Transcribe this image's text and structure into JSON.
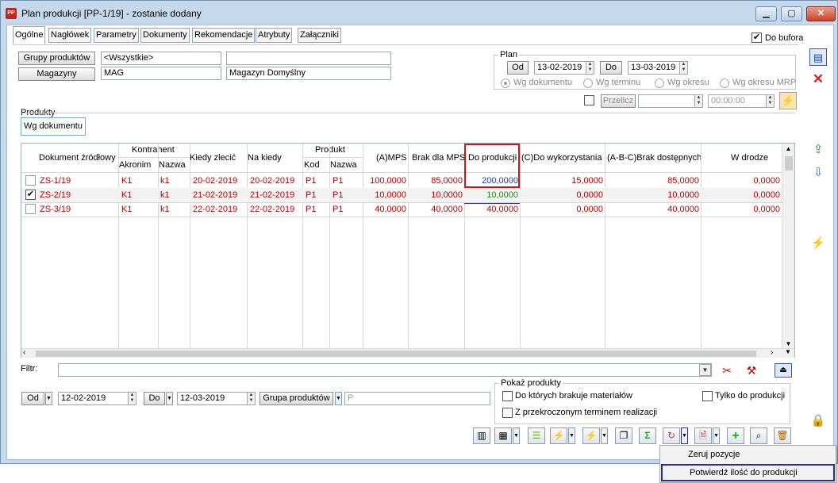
{
  "window": {
    "title": "Plan produkcji [PP-1/19] - zostanie dodany",
    "app_icon": "PP"
  },
  "tabs": [
    "Ogólne",
    "Nagłówek",
    "Parametry",
    "Dokumenty",
    "Rekomendacje",
    "Atrybuty",
    "Załączniki"
  ],
  "do_bufora": {
    "label": "Do bufora",
    "checked": true
  },
  "top": {
    "grupy_produktow_btn": "Grupy produktów",
    "grupy_value": "<Wszystkie>",
    "grupy_desc": "",
    "magazyny_btn": "Magazyny",
    "magazyn_code": "MAG",
    "magazyn_name": "Magazyn Domyślny"
  },
  "plan": {
    "legend": "Plan",
    "od_btn": "Od",
    "od_value": "13-02-2019",
    "do_btn": "Do",
    "do_value": "13-03-2019",
    "radios": [
      "Wg dokumentu",
      "Wg terminu",
      "Wg okresu",
      "Wg okresu MRP"
    ],
    "selected_radio": 0,
    "przelicz_btn": "Przelicz",
    "przelicz_value": "",
    "time_value": "00:00:00"
  },
  "produkty": {
    "label": "Produkty",
    "subtab": "Wg dokumentu"
  },
  "grid": {
    "headers": {
      "dokument": "Dokument źródłowy",
      "kontrahent": "Kontrahent",
      "akronim": "Akronim",
      "nazwa": "Nazwa",
      "kiedy_zlecic": "Kiedy zlecić",
      "na_kiedy": "Na kiedy",
      "produkt": "Produkt",
      "kod": "Kod",
      "prod_nazwa": "Nazwa",
      "amps": "(A)MPS",
      "brak_mps": "Brak dla MPS",
      "do_produkcji": "Do produkcji",
      "c_do_wyk": "(C)Do wykorzystania",
      "abc_brak": "(A-B-C)Brak dostępnych",
      "w_drodze": "W drodze"
    },
    "rows": [
      {
        "checked": false,
        "dok": "ZS-1/19",
        "akronim": "K1",
        "nazwa": "k1",
        "kiedy": "20-02-2019",
        "na_kiedy": "20-02-2019",
        "kod": "P1",
        "pnazwa": "P1",
        "amps": "100,0000",
        "brak": "85,0000",
        "do_prod": "200,0000",
        "c": "15,0000",
        "abc": "85,0000",
        "wdrodze": "0,0000"
      },
      {
        "checked": true,
        "dok": "ZS-2/19",
        "akronim": "K1",
        "nazwa": "k1",
        "kiedy": "21-02-2019",
        "na_kiedy": "21-02-2019",
        "kod": "P1",
        "pnazwa": "P1",
        "amps": "10,0000",
        "brak": "10,0000",
        "do_prod": "10,0000",
        "c": "0,0000",
        "abc": "10,0000",
        "wdrodze": "0,0000"
      },
      {
        "checked": false,
        "dok": "ZS-3/19",
        "akronim": "K1",
        "nazwa": "k1",
        "kiedy": "22-02-2019",
        "na_kiedy": "22-02-2019",
        "kod": "P1",
        "pnazwa": "P1",
        "amps": "40,0000",
        "brak": "40,0000",
        "do_prod": "40,0000",
        "c": "0,0000",
        "abc": "40,0000",
        "wdrodze": "0,0000"
      }
    ]
  },
  "filtr": {
    "label": "Filtr:",
    "value": ""
  },
  "bottom": {
    "od_btn": "Od",
    "od_value": "12-02-2019",
    "do_btn": "Do",
    "do_value": "12-03-2019",
    "grupa_btn": "Grupa produktów",
    "grupa_value": "P"
  },
  "pokaz": {
    "legend": "Pokaż produkty",
    "opt1": "Do których brakuje materiałów",
    "opt2": "Z przekroczonym terminem realizacji",
    "opt3": "Tylko do produkcji"
  },
  "menu": {
    "items": [
      "Zeruj pozycje",
      "Potwierdź ilość do produkcji"
    ]
  },
  "colors": {
    "row_text": "#c00000",
    "highlight_red": "#e01010",
    "highlight_blue": "#2b2b9a",
    "do_prod_blue": "#1a3cc8",
    "do_prod_green": "#1a8a1a"
  }
}
